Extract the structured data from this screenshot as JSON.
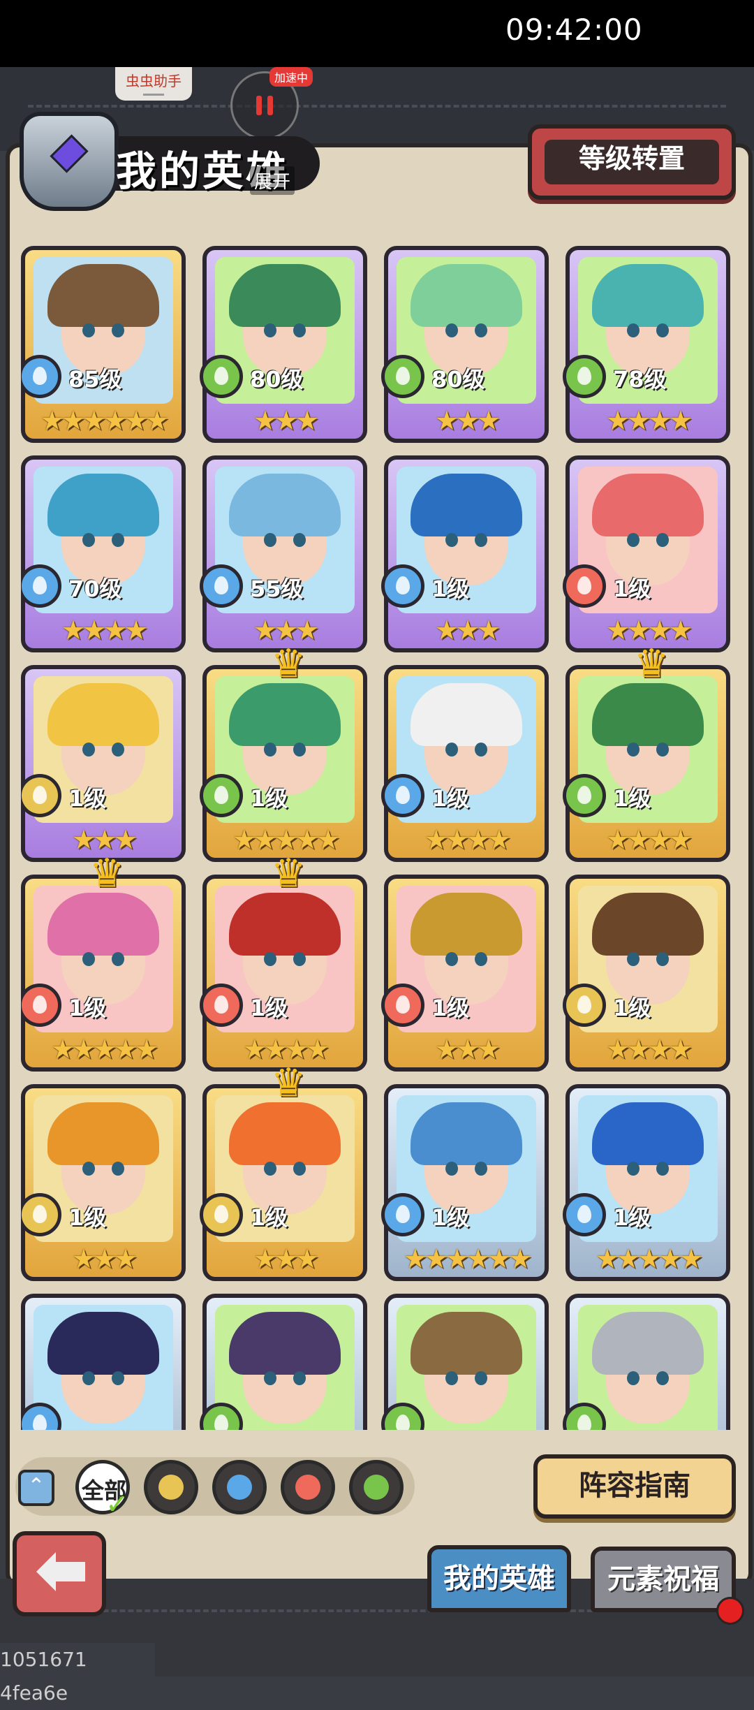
{
  "status_bar": {
    "time": "09:42:00"
  },
  "overlay": {
    "helper_label": "虫虫助手",
    "speed_badge": "加速中"
  },
  "header": {
    "title": "我的英雄",
    "expand_label": "展开",
    "level_transfer_label": "等级转置"
  },
  "heroes": [
    {
      "level": "85级",
      "stars": "★★★★★★",
      "element": "water",
      "frame": "gold",
      "crown": false,
      "hair": "#7a5a3a",
      "bg": "#bfe0f0"
    },
    {
      "level": "80级",
      "stars": "★★★",
      "element": "wind",
      "frame": "purple",
      "crown": false,
      "hair": "#3b8a5a",
      "bg": "#c6ef9a"
    },
    {
      "level": "80级",
      "stars": "★★★",
      "element": "wind",
      "frame": "purple",
      "crown": false,
      "hair": "#7fcf9a",
      "bg": "#c6ef9a"
    },
    {
      "level": "78级",
      "stars": "★★★★",
      "element": "wind",
      "frame": "purple",
      "crown": false,
      "hair": "#4ab3b0",
      "bg": "#c6ef9a"
    },
    {
      "level": "70级",
      "stars": "★★★★",
      "element": "water",
      "frame": "purple",
      "crown": false,
      "hair": "#3fa0c8",
      "bg": "#b8e2f5"
    },
    {
      "level": "55级",
      "stars": "★★★",
      "element": "water",
      "frame": "purple",
      "crown": false,
      "hair": "#7ab8e0",
      "bg": "#b8e2f5"
    },
    {
      "level": "1级",
      "stars": "★★★",
      "element": "water",
      "frame": "purple",
      "crown": false,
      "hair": "#2b6fc0",
      "bg": "#b8e2f5"
    },
    {
      "level": "1级",
      "stars": "★★★★",
      "element": "fire",
      "frame": "purple",
      "crown": false,
      "hair": "#e86a6a",
      "bg": "#f8c4c4"
    },
    {
      "level": "1级",
      "stars": "★★★",
      "element": "earth",
      "frame": "purple",
      "crown": false,
      "hair": "#f2c444",
      "bg": "#f3e1a2"
    },
    {
      "level": "1级",
      "stars": "★★★★★",
      "element": "wind",
      "frame": "gold",
      "crown": true,
      "hair": "#3c9b6a",
      "bg": "#c6ef9a"
    },
    {
      "level": "1级",
      "stars": "★★★★",
      "element": "water",
      "frame": "gold",
      "crown": false,
      "hair": "#f0f0f0",
      "bg": "#b8e2f5"
    },
    {
      "level": "1级",
      "stars": "★★★★",
      "element": "wind",
      "frame": "gold",
      "crown": true,
      "hair": "#3b8a4a",
      "bg": "#c6ef9a"
    },
    {
      "level": "1级",
      "stars": "★★★★★",
      "element": "fire",
      "frame": "gold",
      "crown": true,
      "hair": "#e070a8",
      "bg": "#f8c4c4"
    },
    {
      "level": "1级",
      "stars": "★★★★",
      "element": "fire",
      "frame": "gold",
      "crown": true,
      "hair": "#c0302a",
      "bg": "#f8c4c4"
    },
    {
      "level": "1级",
      "stars": "★★★",
      "element": "fire",
      "frame": "gold",
      "crown": false,
      "hair": "#c89a30",
      "bg": "#f8c4c4"
    },
    {
      "level": "1级",
      "stars": "★★★★",
      "element": "earth",
      "frame": "gold",
      "crown": false,
      "hair": "#6b4628",
      "bg": "#f3e1a2"
    },
    {
      "level": "1级",
      "stars": "★★★",
      "element": "earth",
      "frame": "gold",
      "crown": false,
      "hair": "#e8952a",
      "bg": "#f3e1a2"
    },
    {
      "level": "1级",
      "stars": "★★★",
      "element": "earth",
      "frame": "gold",
      "crown": true,
      "hair": "#f07030",
      "bg": "#f3e1a2"
    },
    {
      "level": "1级",
      "stars": "★★★★★★",
      "element": "water",
      "frame": "blue",
      "crown": false,
      "hair": "#4a8ed0",
      "bg": "#b8e2f5"
    },
    {
      "level": "1级",
      "stars": "★★★★★",
      "element": "water",
      "frame": "blue",
      "crown": false,
      "hair": "#2a66c8",
      "bg": "#b8e2f5"
    },
    {
      "level": "",
      "stars": "",
      "element": "water",
      "frame": "blue",
      "crown": false,
      "hair": "#2a2a5a",
      "bg": "#b8e2f5"
    },
    {
      "level": "",
      "stars": "",
      "element": "wind",
      "frame": "blue",
      "crown": false,
      "hair": "#4a3a6a",
      "bg": "#c6ef9a"
    },
    {
      "level": "",
      "stars": "",
      "element": "wind",
      "frame": "blue",
      "crown": false,
      "hair": "#8a6a40",
      "bg": "#c6ef9a"
    },
    {
      "level": "",
      "stars": "",
      "element": "wind",
      "frame": "blue",
      "crown": false,
      "hair": "#b0b4bc",
      "bg": "#c6ef9a"
    }
  ],
  "filters": {
    "toggle_icon": "chevron-up-icon",
    "all_label": "全部",
    "elements": [
      "earth",
      "water",
      "fire",
      "wind"
    ]
  },
  "guide_label": "阵容指南",
  "tabs": {
    "my_heroes": "我的英雄",
    "element_blessing": "元素祝福"
  },
  "build_id": "1051671 4fea6e",
  "colors": {
    "water": "#5aa8e8",
    "wind": "#79c44a",
    "fire": "#ef6a5a",
    "earth": "#e7c454"
  }
}
